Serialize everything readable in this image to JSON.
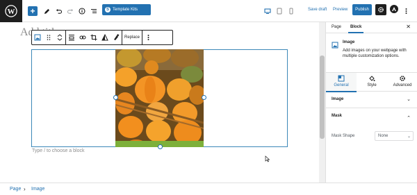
{
  "topbar": {
    "template_kits_label": "Template Kits",
    "save_draft_label": "Save draft",
    "preview_label": "Preview",
    "publish_label": "Publish",
    "accent_color": "#2271b1"
  },
  "editor": {
    "title_placeholder": "Add title",
    "block_toolbar": {
      "replace_label": "Replace"
    },
    "appender_hint": "Type / to choose a block"
  },
  "sidebar": {
    "tabs": {
      "page_label": "Page",
      "block_label": "Block"
    },
    "block_card": {
      "title": "Image",
      "description": "Add images on your webpage with multiple customization options."
    },
    "subtabs": [
      {
        "label": "General",
        "icon": "general-icon",
        "active": true
      },
      {
        "label": "Style",
        "icon": "style-icon"
      },
      {
        "label": "Advanced",
        "icon": "gear-icon"
      }
    ],
    "panels": {
      "image_label": "Image",
      "mask_label": "Mask",
      "mask_shape_label": "Mask Shape",
      "mask_shape_value": "None"
    }
  },
  "footer": {
    "breadcrumb": [
      "Page",
      "Image"
    ]
  }
}
